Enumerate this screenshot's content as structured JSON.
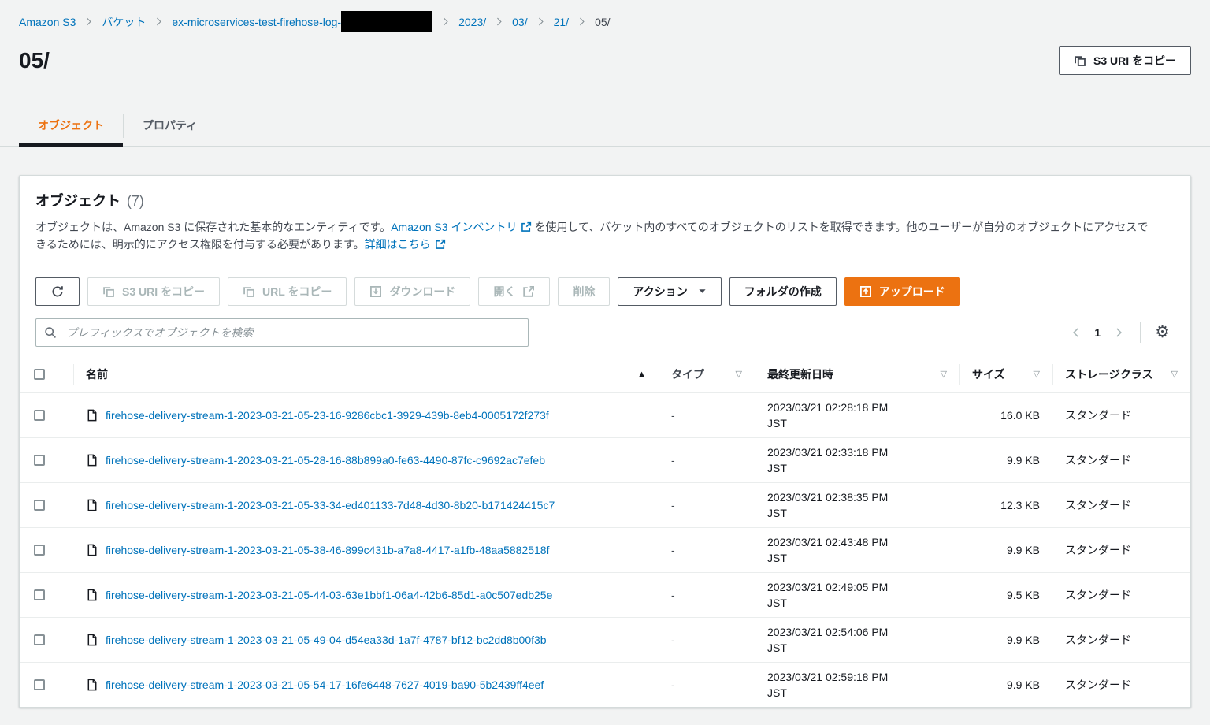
{
  "colors": {
    "accent_orange": "#ec7211",
    "link_blue": "#0073bb",
    "active_tab_underline": "#16191f"
  },
  "breadcrumb": {
    "items": [
      {
        "label": "Amazon S3",
        "type": "link"
      },
      {
        "label": "バケット",
        "type": "link"
      },
      {
        "label": "ex-microservices-test-firehose-log-",
        "type": "link",
        "redacted": true
      },
      {
        "label": "2023/",
        "type": "link"
      },
      {
        "label": "03/",
        "type": "link"
      },
      {
        "label": "21/",
        "type": "link"
      },
      {
        "label": "05/",
        "type": "current"
      }
    ]
  },
  "header": {
    "title": "05/",
    "copy_s3_uri_label": "S3 URI をコピー"
  },
  "tabs": [
    {
      "label": "オブジェクト",
      "active": true
    },
    {
      "label": "プロパティ",
      "active": false
    }
  ],
  "panel": {
    "title": "オブジェクト",
    "count": "(7)",
    "description": [
      {
        "type": "text",
        "text": "オブジェクトは、Amazon S3 に保存された基本的なエンティティです。"
      },
      {
        "type": "link-external",
        "text": "Amazon S3 インベントリ"
      },
      {
        "type": "text",
        "text": "を使用して、バケット内のすべてのオブジェクトのリストを取得できます。他のユーザーが自分のオブジェクトにアクセスできるためには、明示的にアクセス権限を付与する必要があります。"
      },
      {
        "type": "link-external",
        "text": "詳細はこちら"
      }
    ],
    "toolbar": [
      {
        "name": "refresh",
        "icon": "refresh",
        "label": "",
        "state": "normal"
      },
      {
        "name": "copy-s3-uri",
        "icon": "copy",
        "label": "S3 URI をコピー",
        "state": "disabled"
      },
      {
        "name": "copy-url",
        "icon": "copy",
        "label": "URL をコピー",
        "state": "disabled"
      },
      {
        "name": "download",
        "icon": "download",
        "label": "ダウンロード",
        "state": "disabled"
      },
      {
        "name": "open",
        "icon": "external",
        "icon_position": "after",
        "label": "開く",
        "state": "disabled"
      },
      {
        "name": "delete",
        "label": "削除",
        "state": "disabled"
      },
      {
        "name": "actions",
        "label": "アクション",
        "caret": true,
        "state": "normal"
      },
      {
        "name": "create-folder",
        "label": "フォルダの作成",
        "state": "normal"
      },
      {
        "name": "upload",
        "icon": "upload",
        "label": "アップロード",
        "state": "primary"
      }
    ],
    "search": {
      "placeholder": "プレフィックスでオブジェクトを検索"
    },
    "pagination": {
      "page": "1"
    },
    "gear_icon": "⚙"
  },
  "table": {
    "columns": [
      {
        "key": "name",
        "label": "名前",
        "sort": "asc"
      },
      {
        "key": "type",
        "label": "タイプ",
        "sort": "none"
      },
      {
        "key": "modified",
        "label": "最終更新日時",
        "sort": "none"
      },
      {
        "key": "size",
        "label": "サイズ",
        "sort": "none"
      },
      {
        "key": "storage",
        "label": "ストレージクラス",
        "sort": "none"
      }
    ],
    "rows": [
      {
        "name": "firehose-delivery-stream-1-2023-03-21-05-23-16-9286cbc1-3929-439b-8eb4-0005172f273f",
        "type": "-",
        "modified": "2023/03/21 02:28:18 PM",
        "timezone": "JST",
        "size": "16.0 KB",
        "storage_class": "スタンダード"
      },
      {
        "name": "firehose-delivery-stream-1-2023-03-21-05-28-16-88b899a0-fe63-4490-87fc-c9692ac7efeb",
        "type": "-",
        "modified": "2023/03/21 02:33:18 PM",
        "timezone": "JST",
        "size": "9.9 KB",
        "storage_class": "スタンダード"
      },
      {
        "name": "firehose-delivery-stream-1-2023-03-21-05-33-34-ed401133-7d48-4d30-8b20-b171424415c7",
        "type": "-",
        "modified": "2023/03/21 02:38:35 PM",
        "timezone": "JST",
        "size": "12.3 KB",
        "storage_class": "スタンダード"
      },
      {
        "name": "firehose-delivery-stream-1-2023-03-21-05-38-46-899c431b-a7a8-4417-a1fb-48aa5882518f",
        "type": "-",
        "modified": "2023/03/21 02:43:48 PM",
        "timezone": "JST",
        "size": "9.9 KB",
        "storage_class": "スタンダード"
      },
      {
        "name": "firehose-delivery-stream-1-2023-03-21-05-44-03-63e1bbf1-06a4-42b6-85d1-a0c507edb25e",
        "type": "-",
        "modified": "2023/03/21 02:49:05 PM",
        "timezone": "JST",
        "size": "9.5 KB",
        "storage_class": "スタンダード"
      },
      {
        "name": "firehose-delivery-stream-1-2023-03-21-05-49-04-d54ea33d-1a7f-4787-bf12-bc2dd8b00f3b",
        "type": "-",
        "modified": "2023/03/21 02:54:06 PM",
        "timezone": "JST",
        "size": "9.9 KB",
        "storage_class": "スタンダード"
      },
      {
        "name": "firehose-delivery-stream-1-2023-03-21-05-54-17-16fe6448-7627-4019-ba90-5b2439ff4eef",
        "type": "-",
        "modified": "2023/03/21 02:59:18 PM",
        "timezone": "JST",
        "size": "9.9 KB",
        "storage_class": "スタンダード"
      }
    ]
  }
}
